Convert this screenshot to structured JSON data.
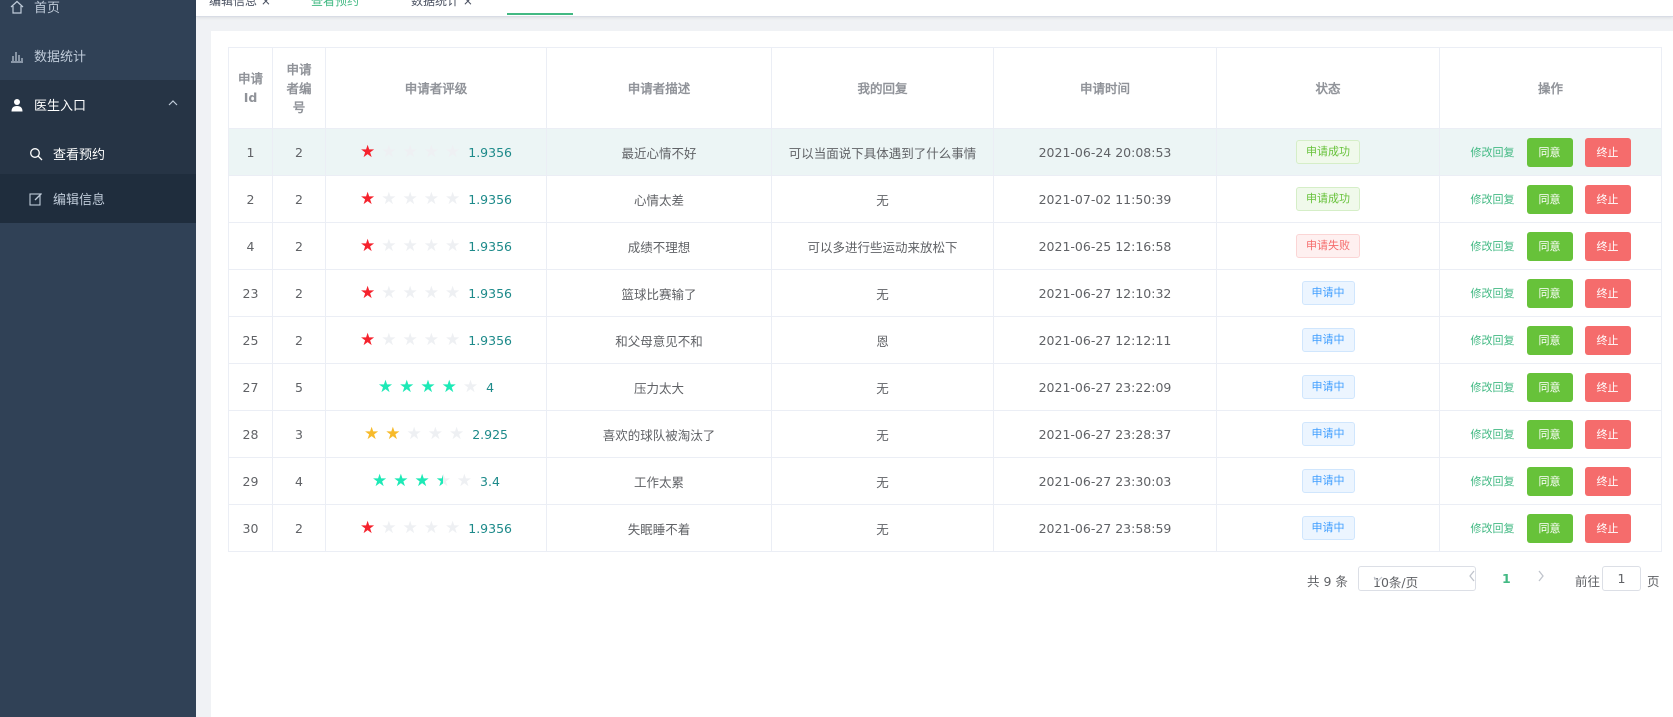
{
  "sidebar": {
    "items": [
      {
        "label": "首页",
        "icon": "home-icon"
      },
      {
        "label": "数据统计",
        "icon": "bar-chart-icon"
      },
      {
        "label": "医生入口",
        "icon": "user-icon"
      },
      {
        "label": "查看预约",
        "icon": "search-icon"
      },
      {
        "label": "编辑信息",
        "icon": "edit-icon"
      }
    ]
  },
  "tags": {
    "items": [
      {
        "label": "编辑信息"
      },
      {
        "label": "查看预约"
      },
      {
        "label": "数据统计"
      }
    ]
  },
  "table": {
    "headers": [
      "申请Id",
      "申请者编号",
      "申请者评级",
      "申请者描述",
      "我的回复",
      "申请时间",
      "状态",
      "操作"
    ],
    "header_id_lines": [
      "申请",
      "Id"
    ],
    "header_no_lines": [
      "申请",
      "者编",
      "号"
    ],
    "action_labels": {
      "edit": "修改回复",
      "agree": "同意",
      "stop": "终止"
    },
    "rows": [
      {
        "id": "1",
        "no": "2",
        "rating": 1.9356,
        "rating_text": "1.9356",
        "star_color": "red",
        "desc": "最近心情不好",
        "reply": "可以当面说下具体遇到了什么事情",
        "time": "2021-06-24 20:08:53",
        "status": "申请成功",
        "status_type": "success"
      },
      {
        "id": "2",
        "no": "2",
        "rating": 1.9356,
        "rating_text": "1.9356",
        "star_color": "red",
        "desc": "心情太差",
        "reply": "无",
        "time": "2021-07-02 11:50:39",
        "status": "申请成功",
        "status_type": "success"
      },
      {
        "id": "4",
        "no": "2",
        "rating": 1.9356,
        "rating_text": "1.9356",
        "star_color": "red",
        "desc": "成绩不理想",
        "reply": "可以多进行些运动来放松下",
        "time": "2021-06-25 12:16:58",
        "status": "申请失败",
        "status_type": "danger"
      },
      {
        "id": "23",
        "no": "2",
        "rating": 1.9356,
        "rating_text": "1.9356",
        "star_color": "red",
        "desc": "篮球比赛输了",
        "reply": "无",
        "time": "2021-06-27 12:10:32",
        "status": "申请中",
        "status_type": "info"
      },
      {
        "id": "25",
        "no": "2",
        "rating": 1.9356,
        "rating_text": "1.9356",
        "star_color": "red",
        "desc": "和父母意见不和",
        "reply": "恩",
        "time": "2021-06-27 12:12:11",
        "status": "申请中",
        "status_type": "info"
      },
      {
        "id": "27",
        "no": "5",
        "rating": 4,
        "rating_text": "4",
        "star_color": "teal",
        "desc": "压力太大",
        "reply": "无",
        "time": "2021-06-27 23:22:09",
        "status": "申请中",
        "status_type": "info"
      },
      {
        "id": "28",
        "no": "3",
        "rating": 2.925,
        "rating_text": "2.925",
        "star_color": "gold",
        "desc": "喜欢的球队被淘汰了",
        "reply": "无",
        "time": "2021-06-27 23:28:37",
        "status": "申请中",
        "status_type": "info"
      },
      {
        "id": "29",
        "no": "4",
        "rating": 3.4,
        "rating_text": "3.4",
        "star_color": "teal",
        "desc": "工作太累",
        "reply": "无",
        "time": "2021-06-27 23:30:03",
        "status": "申请中",
        "status_type": "info"
      },
      {
        "id": "30",
        "no": "2",
        "rating": 1.9356,
        "rating_text": "1.9356",
        "star_color": "red",
        "desc": "失眠睡不着",
        "reply": "无",
        "time": "2021-06-27 23:58:59",
        "status": "申请中",
        "status_type": "info"
      }
    ]
  },
  "pagination": {
    "total": "共 9 条",
    "page_size": "10条/页",
    "current_page": "1",
    "goto_label": "前往",
    "goto_value": "1",
    "page_suffix": "页"
  },
  "colors": {
    "sidebar_bg": "#304156",
    "accent": "#42b983",
    "star_red": "#f5222d",
    "star_teal": "#1de9b6",
    "star_gold": "#f7ba2a",
    "agree": "#67c23a",
    "stop": "#f56c6c"
  }
}
